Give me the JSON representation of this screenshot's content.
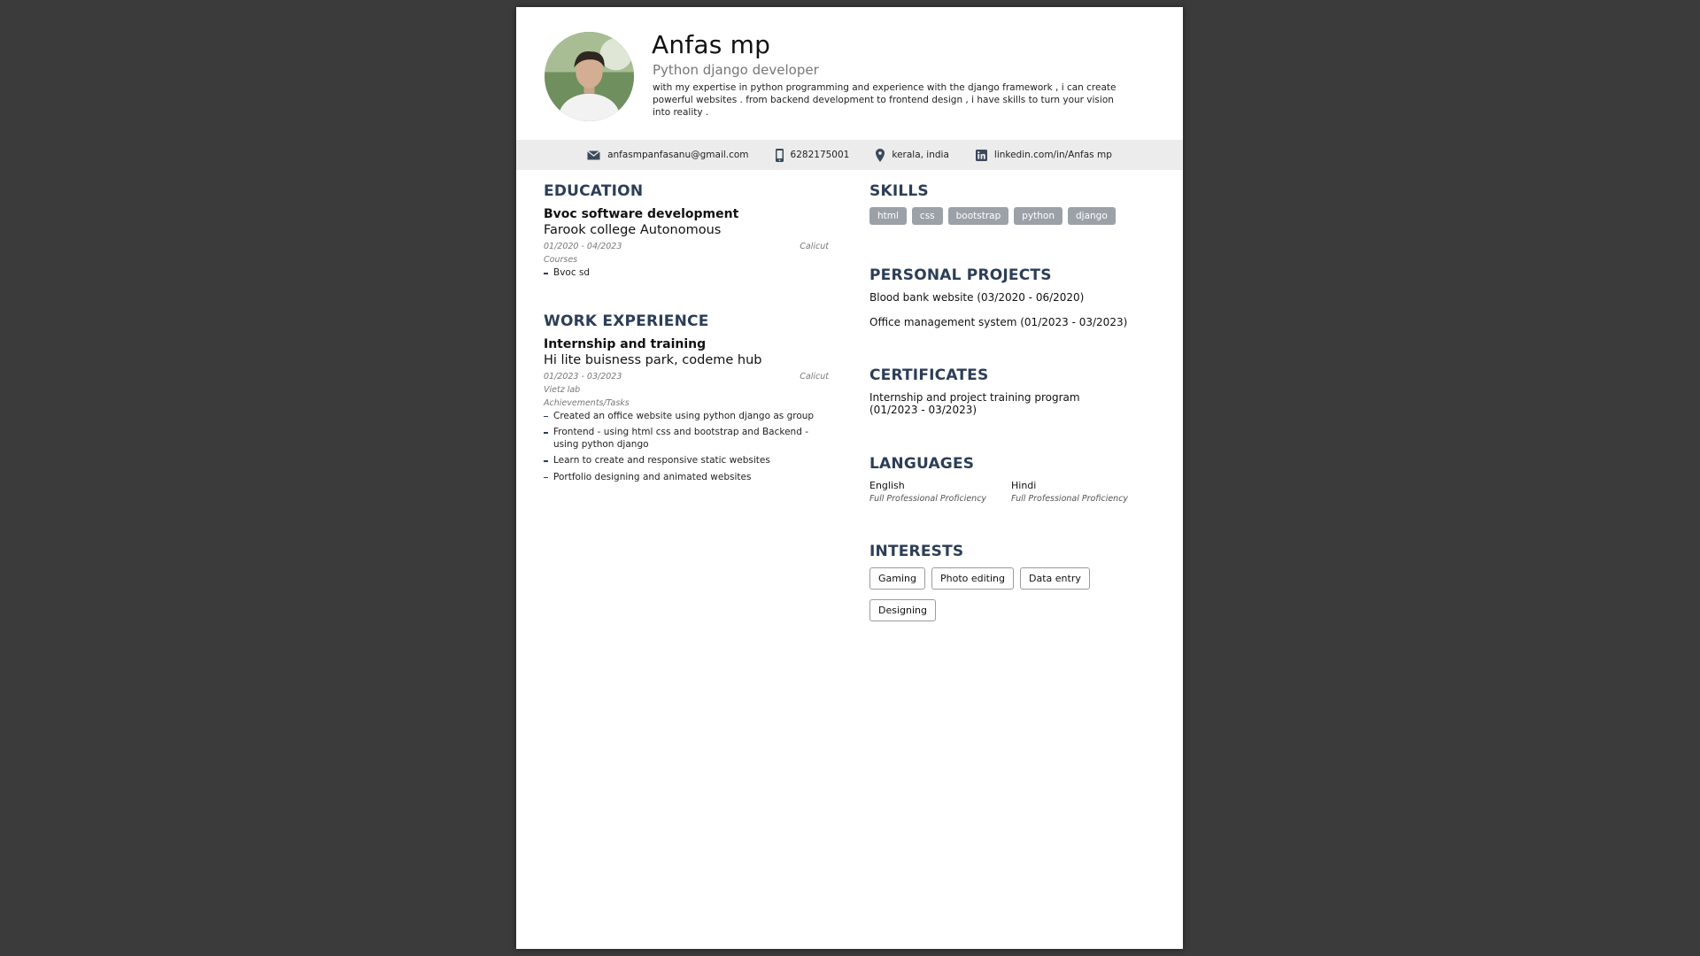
{
  "header": {
    "name": "Anfas mp",
    "role": "Python django developer",
    "summary": "with my expertise in python programming and experience with the django framework , i can create powerful websites . from backend development to frontend design , i have skills to turn your vision into reality ."
  },
  "contact": {
    "email": "anfasmpanfasanu@gmail.com",
    "phone": "6282175001",
    "location": "kerala, india",
    "linkedin": "linkedin.com/in/Anfas mp"
  },
  "education": {
    "title": "EDUCATION",
    "degree": "Bvoc software development",
    "school": "Farook college Autonomous",
    "dates": "01/2020 - 04/2023",
    "location": "Calicut",
    "courses_label": "Courses",
    "courses": [
      "Bvoc sd"
    ]
  },
  "work": {
    "title": "WORK EXPERIENCE",
    "position": "Internship and training",
    "company": "Hi lite buisness park, codeme hub",
    "dates": "01/2023 - 03/2023",
    "location": "Calicut",
    "org": "Vietz lab",
    "tasks_label": "Achievements/Tasks",
    "tasks": [
      "Created an office website using python django as group",
      "Frontend - using html css and bootstrap and Backend - using python django",
      "Learn to create and responsive static websites",
      "Portfolio designing and animated websites"
    ]
  },
  "skills": {
    "title": "SKILLS",
    "items": [
      "html",
      "css",
      "bootstrap",
      "python",
      "django"
    ]
  },
  "projects": {
    "title": "PERSONAL PROJECTS",
    "items": [
      "Blood bank website (03/2020 - 06/2020)",
      "Office management system (01/2023 - 03/2023)"
    ]
  },
  "certificates": {
    "title": "CERTIFICATES",
    "item": "Internship and project training program\n (01/2023 - 03/2023)"
  },
  "languages": {
    "title": "LANGUAGES",
    "items": [
      {
        "name": "English",
        "level": "Full Professional Proficiency"
      },
      {
        "name": "Hindi",
        "level": "Full Professional Proficiency"
      }
    ]
  },
  "interests": {
    "title": "INTERESTS",
    "items": [
      "Gaming",
      "Photo editing",
      "Data entry",
      "Designing"
    ]
  },
  "colors": {
    "background": "#3b3b3b",
    "heading": "#2c3e57",
    "skill_tag": "#9ca1a8",
    "contact_bar": "#ececec"
  },
  "icons": [
    "email-icon",
    "phone-icon",
    "location-icon",
    "linkedin-icon"
  ]
}
